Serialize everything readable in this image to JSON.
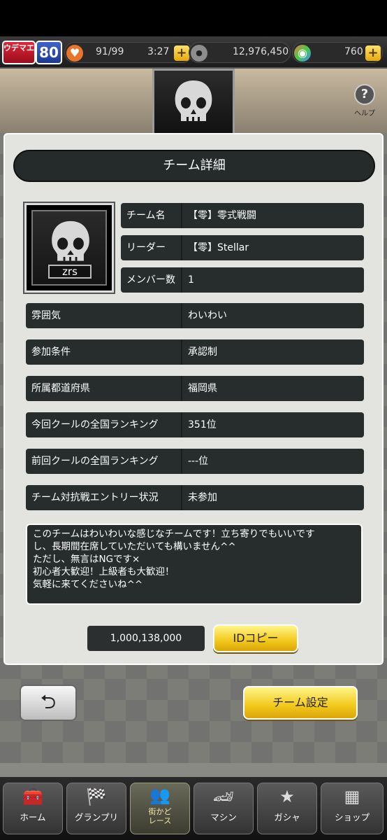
{
  "top_bar": {
    "rank_label": "ウデマエ",
    "rank_value": "80",
    "stamina": "91/99",
    "stamina_timer": "3:27",
    "coins": "12,976,450",
    "gems": "760"
  },
  "help": {
    "label": "ヘルプ"
  },
  "panel": {
    "title": "チーム詳細",
    "emblem_tag": "zrs",
    "fields": [
      {
        "label": "チーム名",
        "value": "【零】零式戦闘"
      },
      {
        "label": "リーダー",
        "value": "【零】Stellar"
      },
      {
        "label": "メンバー数",
        "value": "1"
      },
      {
        "label": "雰囲気",
        "value": "わいわい"
      },
      {
        "label": "参加条件",
        "value": "承認制"
      },
      {
        "label": "所属都道府県",
        "value": "福岡県"
      },
      {
        "label": "今回クールの全国ランキング",
        "value": "351位"
      },
      {
        "label": "前回クールの全国ランキング",
        "value": "---位"
      },
      {
        "label": "チーム対抗戦エントリー状況",
        "value": "未参加"
      }
    ],
    "description": "このチームはわいわいな感じなチームです！立ち寄りでもいいです\nし、長期間在席していただいても構いません^^\nただし、無言はNGです×\n初心者大歓迎！上級者も大歓迎！\n気軽に来てくださいね^^",
    "team_id": "1,000,138,000",
    "id_copy_label": "IDコピー"
  },
  "buttons": {
    "back_glyph": "⮌",
    "team_settings_label": "チーム設定"
  },
  "nav": [
    {
      "label": "ホーム",
      "icon": "toolbox-icon"
    },
    {
      "label": "グランプリ",
      "icon": "checkered-flag-icon"
    },
    {
      "label": "街かど\nレース",
      "icon": "group-icon"
    },
    {
      "label": "マシン",
      "icon": "car-icon"
    },
    {
      "label": "ガシャ",
      "icon": "star-icon"
    },
    {
      "label": "ショップ",
      "icon": "building-icon"
    }
  ]
}
